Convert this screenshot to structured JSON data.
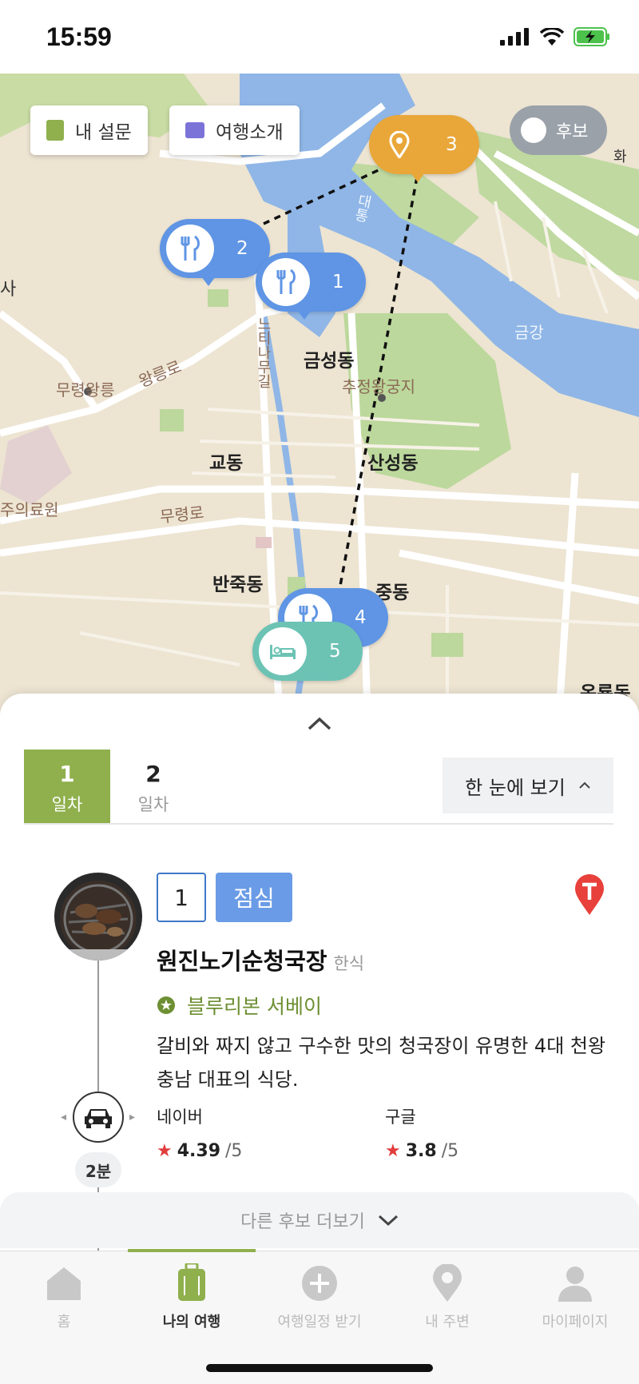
{
  "status_bar": {
    "time": "15:59"
  },
  "map": {
    "chips": {
      "survey": "내 설문",
      "intro": "여행소개"
    },
    "toggle_label": "후보",
    "labels": {
      "geumseong": "금성동",
      "chujeong": "추정왕궁지",
      "muryeong": "무령왕릉",
      "wangneung": "왕릉로",
      "gyodong": "교동",
      "sanseong": "산성동",
      "muryeong_ro": "무령로",
      "banjuk": "반죽동",
      "jungdong": "중동",
      "oryong": "옥룡동",
      "geumgang": "금강",
      "sa": "사",
      "medical": "주의료원",
      "neuti": "느티나무길",
      "daetong": "대통",
      "hwa": "화"
    },
    "pins": [
      {
        "num": "3",
        "color": "#e9a73a",
        "icon": "location-icon"
      },
      {
        "num": "2",
        "color": "#5f95e4",
        "icon": "fork-knife-icon"
      },
      {
        "num": "1",
        "color": "#5f95e4",
        "icon": "fork-knife-icon"
      },
      {
        "num": "4",
        "color": "#5f95e4",
        "icon": "fork-knife-icon"
      },
      {
        "num": "5",
        "color": "#6cc3b4",
        "icon": "bed-icon"
      }
    ]
  },
  "sheet": {
    "days": [
      {
        "num": "1",
        "label": "일차"
      },
      {
        "num": "2",
        "label": "일차"
      }
    ],
    "overview_label": "한 눈에 보기",
    "place": {
      "order": "1",
      "meal": "점심",
      "name": "원진노기순청국장",
      "category": "한식",
      "award": "블루리본 서베이",
      "description": "갈비와 짜지 않고 구수한 맛의 청국장이 유명한 4대 천왕 충남 대표의 식당.",
      "ratings": [
        {
          "source": "네이버",
          "score": "4.39",
          "max": "/5"
        },
        {
          "source": "구글",
          "score": "3.8",
          "max": "/5"
        }
      ],
      "travel_time": "2분"
    },
    "more_label": "다른 후보 더보기"
  },
  "tabbar": {
    "items": [
      "홈",
      "나의 여행",
      "여행일정 받기",
      "내 주변",
      "마이페이지"
    ],
    "active_color": "#8fb04d"
  }
}
